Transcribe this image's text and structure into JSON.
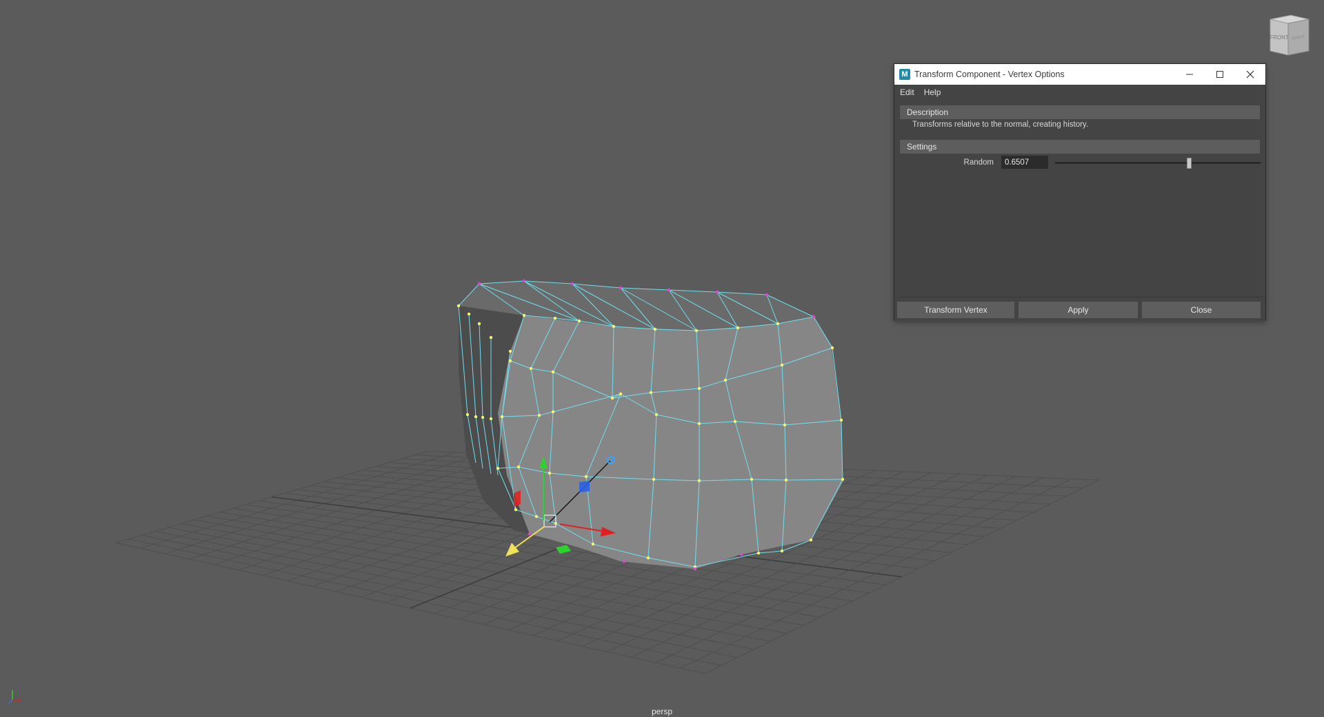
{
  "viewport": {
    "camera_label": "persp",
    "viewcube": {
      "face_front": "FRONT",
      "face_right": "RIGHT"
    }
  },
  "dialog": {
    "title": "Transform Component - Vertex Options",
    "app_icon": "M",
    "menu": [
      "Edit",
      "Help"
    ],
    "description_header": "Description",
    "description_text": "Transforms relative to the normal, creating history.",
    "settings_header": "Settings",
    "random_label": "Random",
    "random_value": "0.6507",
    "random_fraction": 0.6507,
    "buttons": {
      "transform": "Transform Vertex",
      "apply": "Apply",
      "close": "Close"
    }
  },
  "colors": {
    "viewport_bg": "#5b5b5b",
    "mesh_face": "#8c8c8c",
    "mesh_wire": "#6fe0f0",
    "vertex_selected": "#f5f574",
    "vertex_unselected": "#d44bd4",
    "axis_x": "#e02020",
    "axis_y": "#2ed12e",
    "axis_z": "#2b60e6"
  }
}
